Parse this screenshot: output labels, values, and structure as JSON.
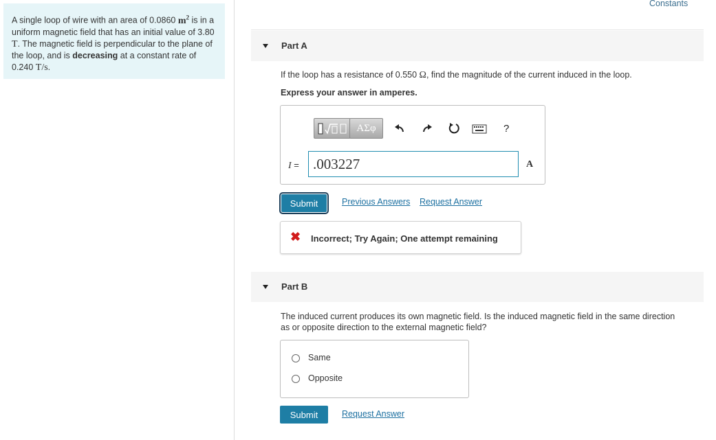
{
  "problem": {
    "p1": "A single loop of wire with an area of 0.0860 ",
    "area_unit_base": "m",
    "area_unit_exp": "2",
    "p2": " is in a uniform magnetic field that has an initial value of 3.80 ",
    "field_unit": "T",
    "p3": ". The magnetic field is perpendicular to the plane of the loop, and is ",
    "p3_bold": "decreasing",
    "p4": " at a constant rate of 0.240 ",
    "rate_unit": "T/s",
    "p5": "."
  },
  "header": {
    "constants_link": "Constants"
  },
  "part_a": {
    "title": "Part A",
    "q1": "If the loop has a resistance of 0.550 ",
    "ohm": "Ω",
    "q2": ", find the magnitude of the current induced in the loop.",
    "instruction": "Express your answer in amperes.",
    "toolbar": {
      "template_icon": "template-icon",
      "greek_label": "ΑΣφ",
      "undo_icon": "undo-icon",
      "redo_icon": "redo-icon",
      "reset_icon": "reset-icon",
      "keyboard_icon": "keyboard-icon",
      "help_label": "?"
    },
    "var_name": "I",
    "equals": " =",
    "answer_value": ".003227",
    "unit": "A",
    "submit_label": "Submit",
    "prev_answers_link": "Previous Answers",
    "request_answer_link": "Request Answer",
    "feedback_icon": "✖",
    "feedback": "Incorrect; Try Again; One attempt remaining"
  },
  "part_b": {
    "title": "Part B",
    "question_line1": "The induced current produces its own magnetic field.  Is the induced magnetic field in the same direction",
    "question_line2": "as or opposite direction to the external magnetic field?",
    "options": [
      "Same",
      "Opposite"
    ],
    "submit_label": "Submit",
    "request_answer_link": "Request Answer"
  },
  "colors": {
    "accent": "#1e7ea5",
    "problem_bg": "#e6f5f8",
    "error": "#d11b1b",
    "link": "#1b6fa0"
  }
}
